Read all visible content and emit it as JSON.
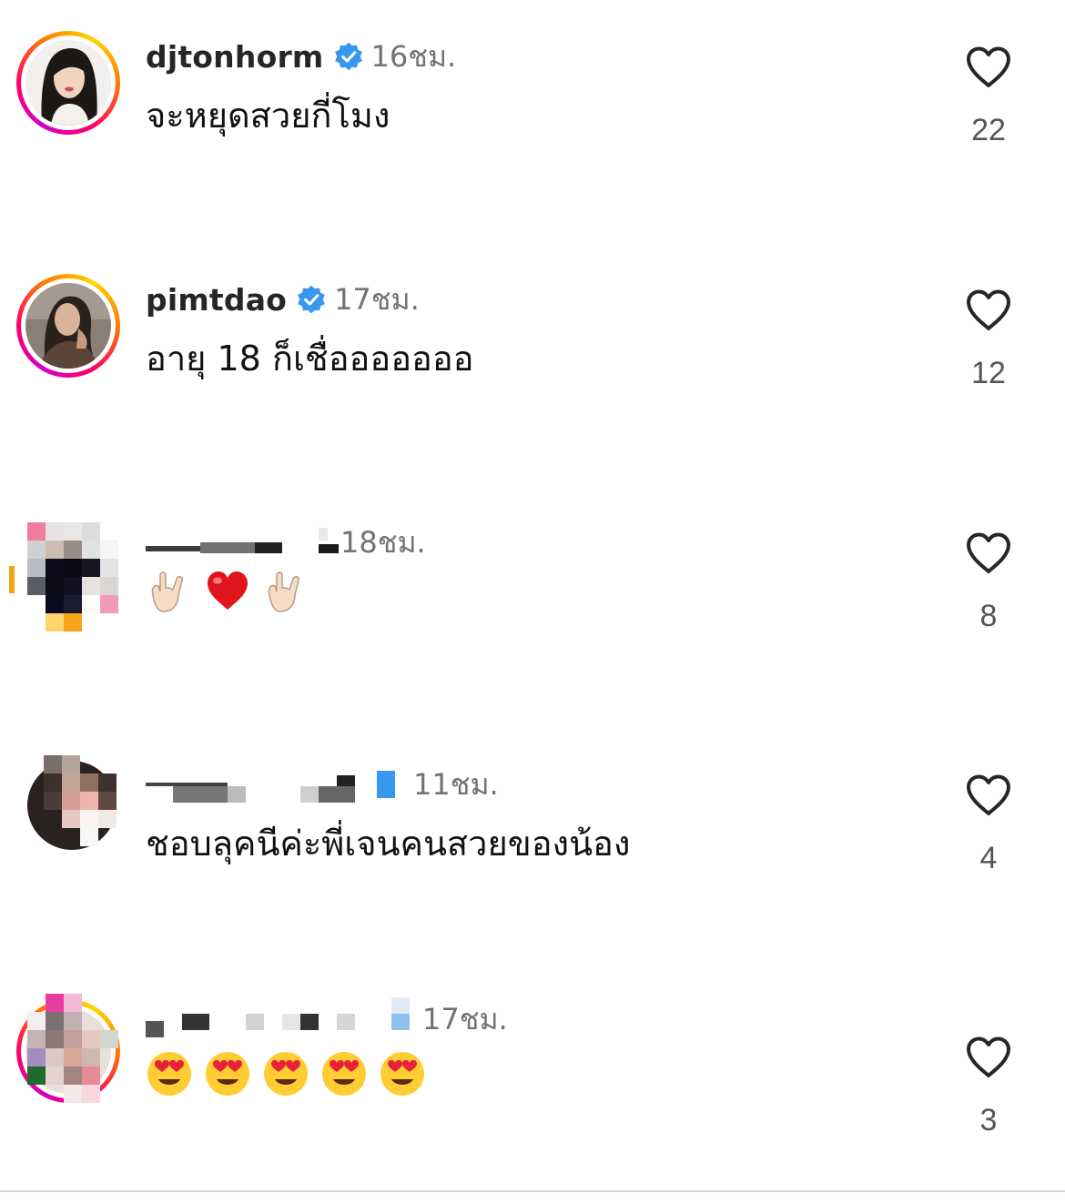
{
  "comments": [
    {
      "username": "djtonhorm",
      "verified": true,
      "time": "16ชม.",
      "text": "จะหยุดสวยกี่โมง",
      "likes": "22"
    },
    {
      "username": "pimtdao",
      "verified": true,
      "time": "17ชม.",
      "text": "อายุ 18 ก็เชื่อออออออ",
      "likes": "12"
    },
    {
      "username": "",
      "verified": false,
      "time": "18ชม.",
      "emojis": [
        "rock-on-hand",
        "red-heart",
        "rock-on-hand"
      ],
      "likes": "8"
    },
    {
      "username": "",
      "verified": true,
      "time": "11ชม.",
      "text": "ชอบลุคนีค่ะพี่เจนคนสวยของน้อง",
      "likes": "4"
    },
    {
      "username": "",
      "verified": true,
      "time": "17ชม.",
      "emojis": [
        "heart-eyes",
        "heart-eyes",
        "heart-eyes",
        "heart-eyes",
        "heart-eyes"
      ],
      "likes": "3"
    }
  ],
  "icons": {
    "like": "heart-outline-icon",
    "verified": "verified-badge-icon"
  },
  "colors": {
    "verified": "#3897f0",
    "muted_text": "#737373",
    "heart_stroke": "#262626"
  }
}
